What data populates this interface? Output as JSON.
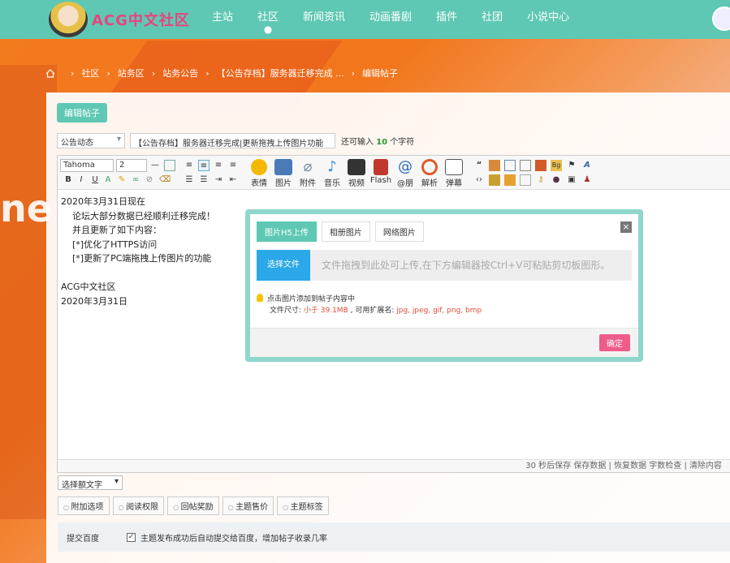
{
  "header": {
    "logo_text": "ACG中文社区",
    "nav": [
      "主站",
      "社区",
      "新闻资讯",
      "动画番剧",
      "插件",
      "社团",
      "小说中心"
    ],
    "active_nav": "社区"
  },
  "breadcrumb": [
    "社区",
    "站务区",
    "站务公告",
    "【公告存档】服务器迁移完成 ...",
    "编辑帖子"
  ],
  "editor_tab": "编辑帖子",
  "post": {
    "type_select": "公告动态",
    "title": "【公告存档】服务器迁移完成|更新拖拽上传图片功能",
    "hint_prefix": "还可输入",
    "hint_count": "10",
    "hint_suffix": "个字符"
  },
  "toolbar": {
    "font": "Tahoma",
    "size": "2",
    "small_buttons": [
      "B",
      "I",
      "U"
    ],
    "big_buttons": [
      {
        "label": "表情",
        "icon": "smiley-icon",
        "color": "#f5b800"
      },
      {
        "label": "图片",
        "icon": "image-icon",
        "color": "#4a7ab8"
      },
      {
        "label": "附件",
        "icon": "paperclip-icon",
        "color": "#7a8a9a"
      },
      {
        "label": "音乐",
        "icon": "music-note-icon",
        "color": "#3a8ad8"
      },
      {
        "label": "视频",
        "icon": "film-icon",
        "color": "#333333"
      },
      {
        "label": "Flash",
        "icon": "flash-icon",
        "color": "#c0392b"
      },
      {
        "label": "@朋",
        "icon": "at-icon",
        "color": "#2a6ab8"
      },
      {
        "label": "解析",
        "icon": "parse-icon",
        "color": "#e05a2a"
      },
      {
        "label": "弹幕",
        "icon": "danmaku-icon",
        "color": "#555555"
      }
    ]
  },
  "content": {
    "lines": [
      {
        "text": "2020年3月31日现在",
        "indent": false
      },
      {
        "text": "论坛大部分数据已经顺利迁移完成！",
        "indent": true
      },
      {
        "text": "并且更新了如下内容：",
        "indent": true
      },
      {
        "text": "[*]优化了HTTPS访问",
        "indent": true
      },
      {
        "text": "[*]更新了PC端拖拽上传图片的功能",
        "indent": true
      },
      {
        "text": "",
        "indent": false
      },
      {
        "text": "ACG中文社区",
        "indent": false
      },
      {
        "text": "2020年3月31日",
        "indent": false
      }
    ]
  },
  "status_bar": "30 秒后保存 保存数据 | 恢复数据    字数检查 | 清除内容",
  "extra_select": "选择额文字",
  "options": [
    "附加选项",
    "阅读权限",
    "回帖奖励",
    "主题售价",
    "主题标签"
  ],
  "baidu": {
    "label": "提交百度",
    "checkbox_text": "主题发布成功后自动提交给百度，增加帖子收录几率",
    "checked": true
  },
  "upload_dialog": {
    "tabs": [
      "图片H5上传",
      "相册图片",
      "网络图片"
    ],
    "close": "×",
    "choose_button": "选择文件",
    "drop_text": "文件拖拽到此处可上传,在下方编辑器按Ctrl+V可粘贴剪切板图形。",
    "tip1": "点击图片添加到帖子内容中",
    "tip2_prefix": "文件尺寸: ",
    "tip2_size": "小于 39.1MB",
    "tip2_mid": " , 可用扩展名: ",
    "tip2_ext": "jpg, jpeg, gif, png, bmp",
    "ok_button": "确定"
  },
  "colors": {
    "header": "#5ec8b4",
    "accent_pink": "#ee5c8a",
    "upload_blue": "#2aa8e8",
    "logo": "#e9437d"
  }
}
